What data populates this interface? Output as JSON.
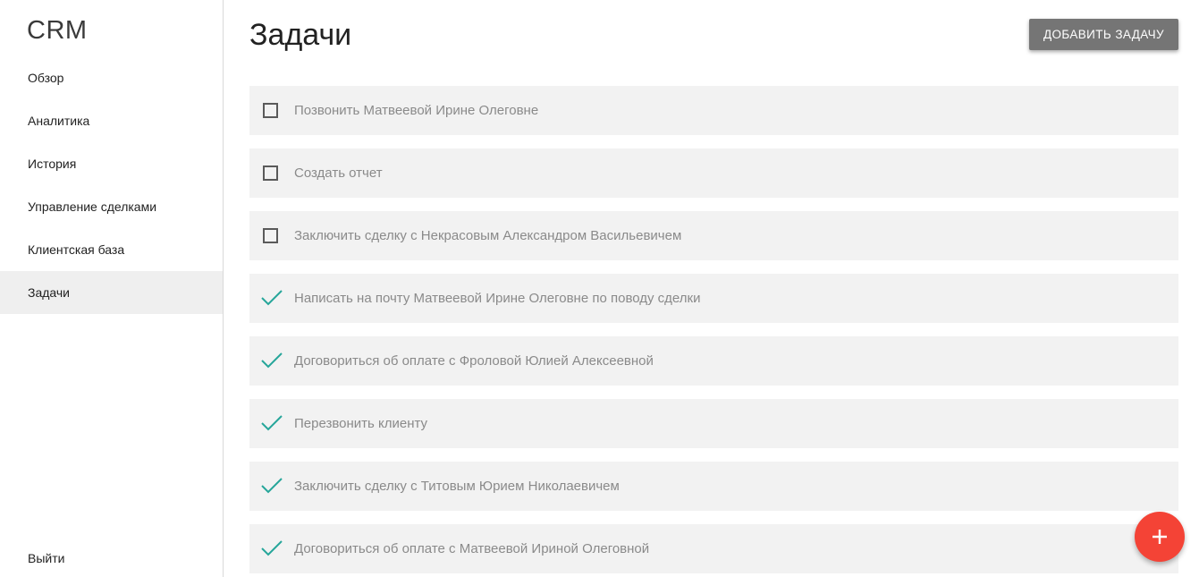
{
  "app": {
    "logo": "CRM"
  },
  "sidebar": {
    "items": [
      {
        "label": "Обзор",
        "active": false
      },
      {
        "label": "Аналитика",
        "active": false
      },
      {
        "label": "История",
        "active": false
      },
      {
        "label": "Управление сделками",
        "active": false
      },
      {
        "label": "Клиентская база",
        "active": false
      },
      {
        "label": "Задачи",
        "active": true
      }
    ],
    "logout_label": "Выйти"
  },
  "main": {
    "title": "Задачи",
    "add_button_label": "ДОБАВИТЬ ЗАДАЧУ",
    "tasks": [
      {
        "text": "Позвонить Матвеевой Ирине Олеговне",
        "done": false
      },
      {
        "text": "Создать отчет",
        "done": false
      },
      {
        "text": "Заключить сделку с Некрасовым Александром Васильевичем",
        "done": false
      },
      {
        "text": "Написать на почту Матвеевой Ирине Олеговне по поводу сделки",
        "done": true
      },
      {
        "text": "Договориться об оплате с Фроловой Юлией Алексеевной",
        "done": true
      },
      {
        "text": "Перезвонить клиенту",
        "done": true
      },
      {
        "text": "Заключить сделку с Титовым Юрием Николаевичем",
        "done": true
      },
      {
        "text": "Договориться об оплате с Матвеевой Ириной Олеговной",
        "done": true
      }
    ]
  },
  "fab": {
    "icon": "plus-icon"
  },
  "colors": {
    "accent_check": "#26a69a",
    "fab": "#f44336",
    "button": "#757575",
    "task_bg": "#f2f2f2",
    "active_nav_bg": "#efefef"
  }
}
